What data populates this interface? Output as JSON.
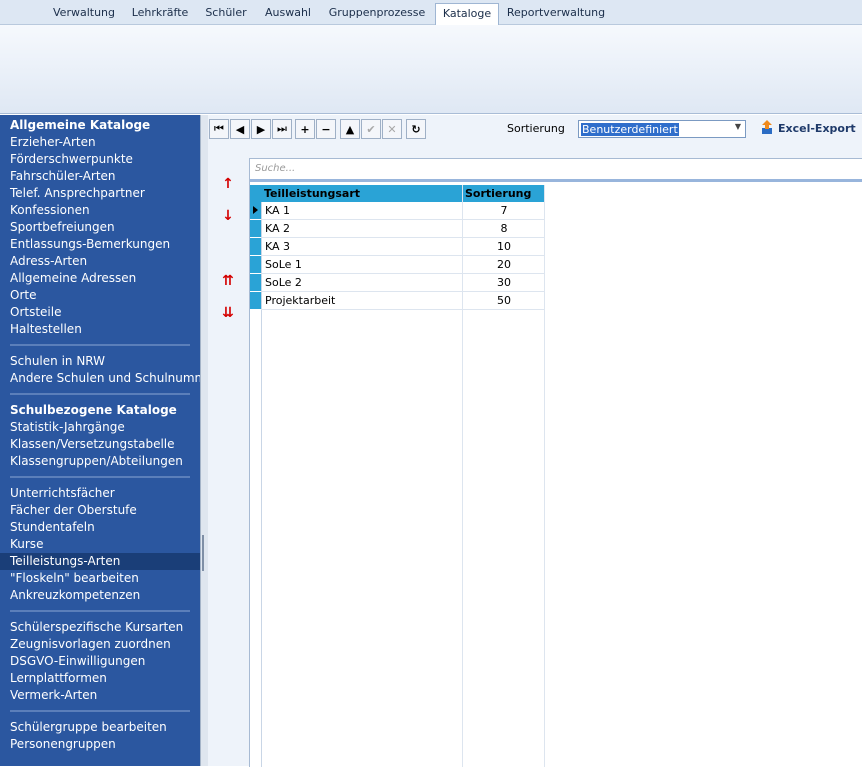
{
  "tabs": [
    {
      "label": "Verwaltung",
      "active": false
    },
    {
      "label": "Lehrkräfte",
      "active": false
    },
    {
      "label": "Schüler",
      "active": false
    },
    {
      "label": "Auswahl",
      "active": false
    },
    {
      "label": "Gruppenprozesse",
      "active": false
    },
    {
      "label": "Kataloge",
      "active": true
    },
    {
      "label": "Reportverwaltung",
      "active": false
    }
  ],
  "sidebar": {
    "items": [
      {
        "label": "Allgemeine Kataloge",
        "type": "header"
      },
      {
        "label": "Erzieher-Arten"
      },
      {
        "label": "Förderschwerpunkte"
      },
      {
        "label": "Fahrschüler-Arten"
      },
      {
        "label": "Telef. Ansprechpartner"
      },
      {
        "label": "Konfessionen"
      },
      {
        "label": "Sportbefreiungen"
      },
      {
        "label": "Entlassungs-Bemerkungen"
      },
      {
        "label": "Adress-Arten"
      },
      {
        "label": "Allgemeine Adressen"
      },
      {
        "label": "Orte"
      },
      {
        "label": "Ortsteile"
      },
      {
        "label": "Haltestellen"
      },
      {
        "label": "Schulen in NRW"
      },
      {
        "label": "Andere Schulen und Schulnummern"
      },
      {
        "label": "Schulbezogene Kataloge",
        "type": "header"
      },
      {
        "label": "Statistik-Jahrgänge"
      },
      {
        "label": "Klassen/Versetzungstabelle"
      },
      {
        "label": "Klassengruppen/Abteilungen"
      },
      {
        "label": "Unterrichtsfächer"
      },
      {
        "label": "Fächer der Oberstufe"
      },
      {
        "label": "Stundentafeln"
      },
      {
        "label": "Kurse"
      },
      {
        "label": "Teilleistungs-Arten",
        "selected": true
      },
      {
        "label": "\"Floskeln\" bearbeiten"
      },
      {
        "label": "Ankreuzkompetenzen"
      },
      {
        "label": "Schülerspezifische Kursarten"
      },
      {
        "label": "Zeugnisvorlagen zuordnen"
      },
      {
        "label": "DSGVO-Einwilligungen"
      },
      {
        "label": "Lernplattformen"
      },
      {
        "label": "Vermerk-Arten"
      },
      {
        "label": "Schülergruppe bearbeiten"
      },
      {
        "label": "Personengruppen"
      }
    ]
  },
  "toolbar": {
    "buttons": [
      {
        "name": "first-record-button",
        "glyph": "⏮",
        "icon": "first-icon",
        "enabled": true
      },
      {
        "name": "prev-record-button",
        "glyph": "◀",
        "icon": "prev-icon",
        "enabled": true
      },
      {
        "name": "next-record-button",
        "glyph": "▶",
        "icon": "next-icon",
        "enabled": true
      },
      {
        "name": "last-record-button",
        "glyph": "⏭",
        "icon": "last-icon",
        "enabled": true
      },
      {
        "name": "add-record-button",
        "glyph": "+",
        "icon": "plus-icon",
        "enabled": true
      },
      {
        "name": "delete-record-button",
        "glyph": "−",
        "icon": "minus-icon",
        "enabled": true
      },
      {
        "name": "edit-record-button",
        "glyph": "▲",
        "icon": "edit-icon",
        "enabled": true
      },
      {
        "name": "post-record-button",
        "glyph": "✔",
        "icon": "check-icon",
        "enabled": false
      },
      {
        "name": "cancel-record-button",
        "glyph": "✕",
        "icon": "close-icon",
        "enabled": false
      },
      {
        "name": "refresh-button",
        "glyph": "↻",
        "icon": "refresh-icon",
        "enabled": true
      }
    ],
    "sort_label": "Sortierung",
    "sort_value": "Benutzerdefiniert",
    "excel_label": "Excel-Export"
  },
  "search": {
    "placeholder": "Suche..."
  },
  "grid": {
    "columns": [
      "Teilleistungsart",
      "Sortierung"
    ],
    "rows": [
      {
        "name": "KA 1",
        "sort": "7",
        "current": true
      },
      {
        "name": "KA 2",
        "sort": "8"
      },
      {
        "name": "KA 3",
        "sort": "10"
      },
      {
        "name": "SoLe 1",
        "sort": "20"
      },
      {
        "name": "SoLe 2",
        "sort": "30"
      },
      {
        "name": "Projektarbeit",
        "sort": "50"
      }
    ]
  },
  "colors": {
    "sidebar_bg": "#2b57a0",
    "sidebar_selected": "#1a3e78",
    "grid_header": "#2aa3d6",
    "move_arrows": "#d40000"
  }
}
